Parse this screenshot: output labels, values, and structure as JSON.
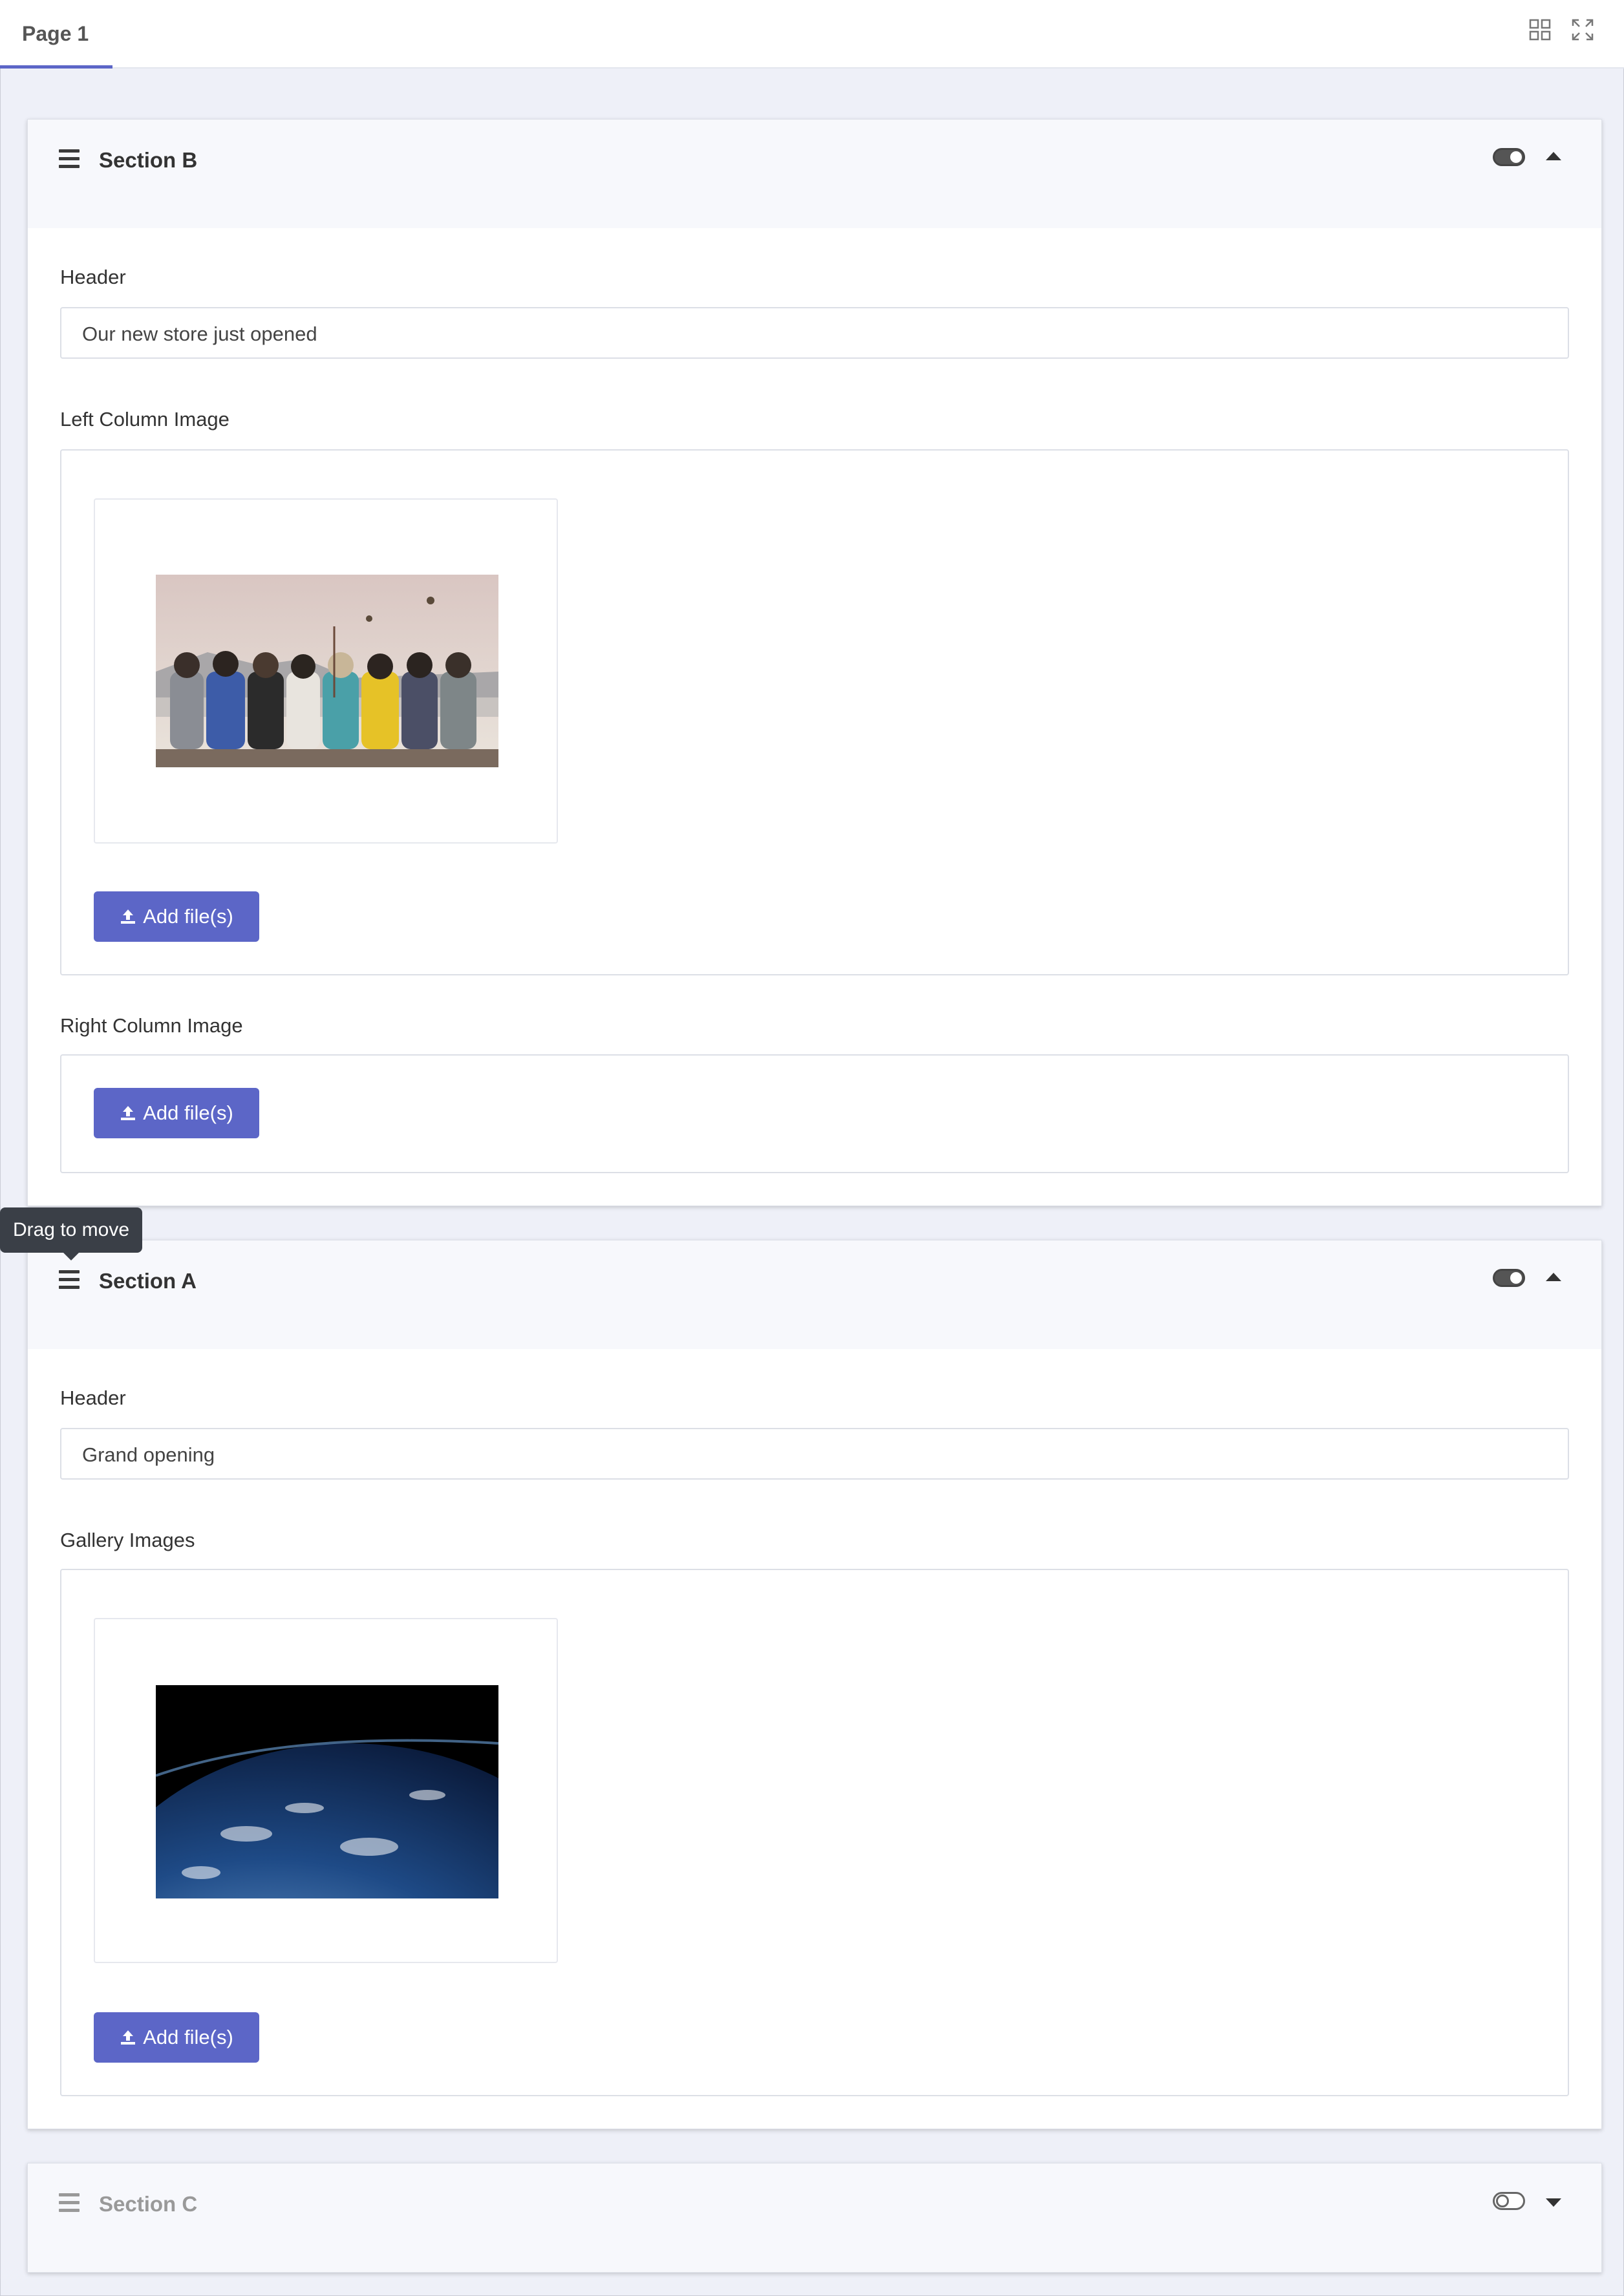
{
  "tab": {
    "label": "Page 1"
  },
  "toolbar": {
    "grid_icon": "grid-icon",
    "fullscreen_icon": "expand-icon"
  },
  "tooltip": "Drag to move",
  "sections": [
    {
      "title": "Section B",
      "enabled": true,
      "expanded": true,
      "header_label": "Header",
      "header_value": "Our new store just opened",
      "left_image_label": "Left Column Image",
      "right_image_label": "Right Column Image",
      "add_files_label": "Add file(s)"
    },
    {
      "title": "Section A",
      "enabled": true,
      "expanded": true,
      "header_label": "Header",
      "header_value": "Grand opening",
      "gallery_label": "Gallery Images",
      "add_files_label": "Add file(s)"
    },
    {
      "title": "Section C",
      "enabled": false,
      "expanded": false
    }
  ],
  "colors": {
    "accent": "#5c66c7",
    "background": "#eef0f8"
  }
}
